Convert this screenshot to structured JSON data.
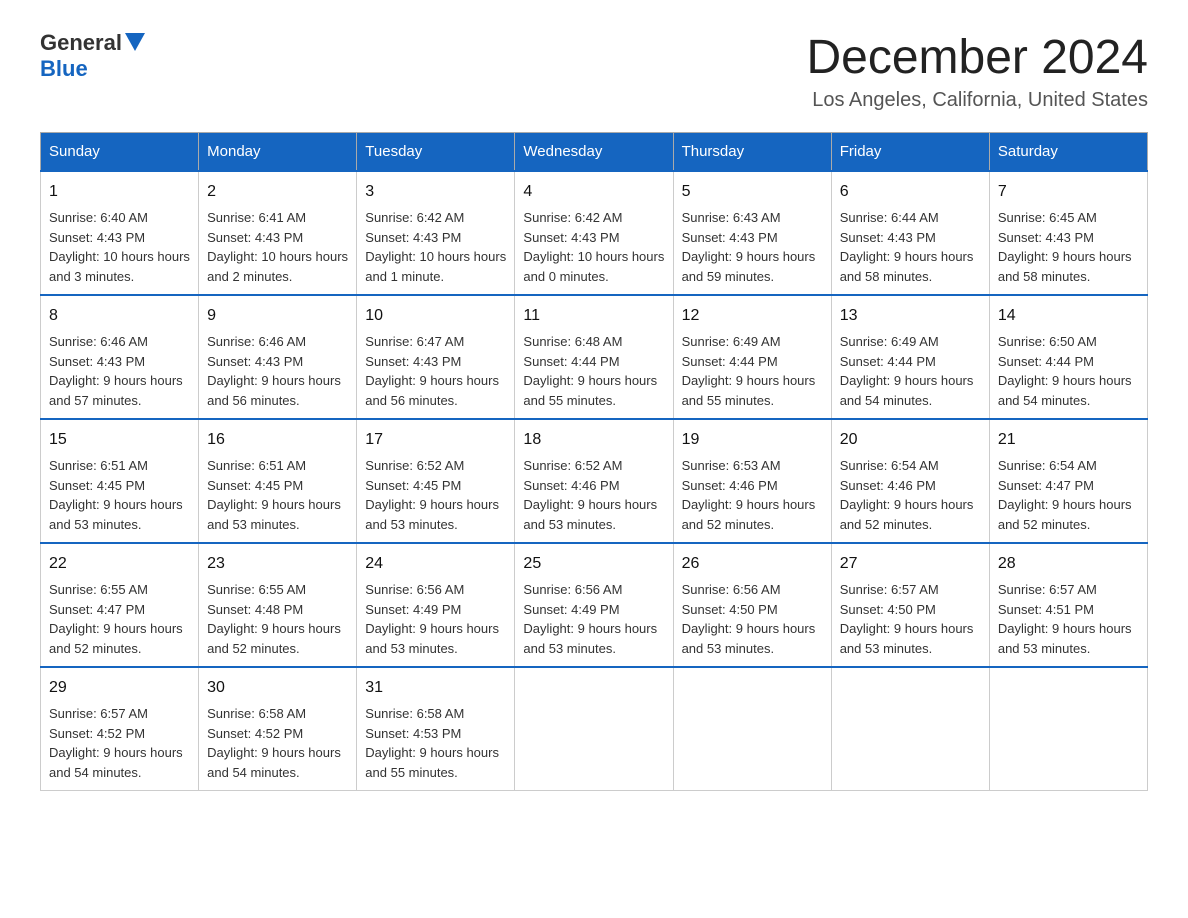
{
  "header": {
    "logo_general": "General",
    "logo_blue": "Blue",
    "title": "December 2024",
    "subtitle": "Los Angeles, California, United States"
  },
  "columns": [
    "Sunday",
    "Monday",
    "Tuesday",
    "Wednesday",
    "Thursday",
    "Friday",
    "Saturday"
  ],
  "weeks": [
    [
      {
        "day": "1",
        "sunrise": "6:40 AM",
        "sunset": "4:43 PM",
        "daylight": "10 hours and 3 minutes."
      },
      {
        "day": "2",
        "sunrise": "6:41 AM",
        "sunset": "4:43 PM",
        "daylight": "10 hours and 2 minutes."
      },
      {
        "day": "3",
        "sunrise": "6:42 AM",
        "sunset": "4:43 PM",
        "daylight": "10 hours and 1 minute."
      },
      {
        "day": "4",
        "sunrise": "6:42 AM",
        "sunset": "4:43 PM",
        "daylight": "10 hours and 0 minutes."
      },
      {
        "day": "5",
        "sunrise": "6:43 AM",
        "sunset": "4:43 PM",
        "daylight": "9 hours and 59 minutes."
      },
      {
        "day": "6",
        "sunrise": "6:44 AM",
        "sunset": "4:43 PM",
        "daylight": "9 hours and 58 minutes."
      },
      {
        "day": "7",
        "sunrise": "6:45 AM",
        "sunset": "4:43 PM",
        "daylight": "9 hours and 58 minutes."
      }
    ],
    [
      {
        "day": "8",
        "sunrise": "6:46 AM",
        "sunset": "4:43 PM",
        "daylight": "9 hours and 57 minutes."
      },
      {
        "day": "9",
        "sunrise": "6:46 AM",
        "sunset": "4:43 PM",
        "daylight": "9 hours and 56 minutes."
      },
      {
        "day": "10",
        "sunrise": "6:47 AM",
        "sunset": "4:43 PM",
        "daylight": "9 hours and 56 minutes."
      },
      {
        "day": "11",
        "sunrise": "6:48 AM",
        "sunset": "4:44 PM",
        "daylight": "9 hours and 55 minutes."
      },
      {
        "day": "12",
        "sunrise": "6:49 AM",
        "sunset": "4:44 PM",
        "daylight": "9 hours and 55 minutes."
      },
      {
        "day": "13",
        "sunrise": "6:49 AM",
        "sunset": "4:44 PM",
        "daylight": "9 hours and 54 minutes."
      },
      {
        "day": "14",
        "sunrise": "6:50 AM",
        "sunset": "4:44 PM",
        "daylight": "9 hours and 54 minutes."
      }
    ],
    [
      {
        "day": "15",
        "sunrise": "6:51 AM",
        "sunset": "4:45 PM",
        "daylight": "9 hours and 53 minutes."
      },
      {
        "day": "16",
        "sunrise": "6:51 AM",
        "sunset": "4:45 PM",
        "daylight": "9 hours and 53 minutes."
      },
      {
        "day": "17",
        "sunrise": "6:52 AM",
        "sunset": "4:45 PM",
        "daylight": "9 hours and 53 minutes."
      },
      {
        "day": "18",
        "sunrise": "6:52 AM",
        "sunset": "4:46 PM",
        "daylight": "9 hours and 53 minutes."
      },
      {
        "day": "19",
        "sunrise": "6:53 AM",
        "sunset": "4:46 PM",
        "daylight": "9 hours and 52 minutes."
      },
      {
        "day": "20",
        "sunrise": "6:54 AM",
        "sunset": "4:46 PM",
        "daylight": "9 hours and 52 minutes."
      },
      {
        "day": "21",
        "sunrise": "6:54 AM",
        "sunset": "4:47 PM",
        "daylight": "9 hours and 52 minutes."
      }
    ],
    [
      {
        "day": "22",
        "sunrise": "6:55 AM",
        "sunset": "4:47 PM",
        "daylight": "9 hours and 52 minutes."
      },
      {
        "day": "23",
        "sunrise": "6:55 AM",
        "sunset": "4:48 PM",
        "daylight": "9 hours and 52 minutes."
      },
      {
        "day": "24",
        "sunrise": "6:56 AM",
        "sunset": "4:49 PM",
        "daylight": "9 hours and 53 minutes."
      },
      {
        "day": "25",
        "sunrise": "6:56 AM",
        "sunset": "4:49 PM",
        "daylight": "9 hours and 53 minutes."
      },
      {
        "day": "26",
        "sunrise": "6:56 AM",
        "sunset": "4:50 PM",
        "daylight": "9 hours and 53 minutes."
      },
      {
        "day": "27",
        "sunrise": "6:57 AM",
        "sunset": "4:50 PM",
        "daylight": "9 hours and 53 minutes."
      },
      {
        "day": "28",
        "sunrise": "6:57 AM",
        "sunset": "4:51 PM",
        "daylight": "9 hours and 53 minutes."
      }
    ],
    [
      {
        "day": "29",
        "sunrise": "6:57 AM",
        "sunset": "4:52 PM",
        "daylight": "9 hours and 54 minutes."
      },
      {
        "day": "30",
        "sunrise": "6:58 AM",
        "sunset": "4:52 PM",
        "daylight": "9 hours and 54 minutes."
      },
      {
        "day": "31",
        "sunrise": "6:58 AM",
        "sunset": "4:53 PM",
        "daylight": "9 hours and 55 minutes."
      },
      null,
      null,
      null,
      null
    ]
  ]
}
